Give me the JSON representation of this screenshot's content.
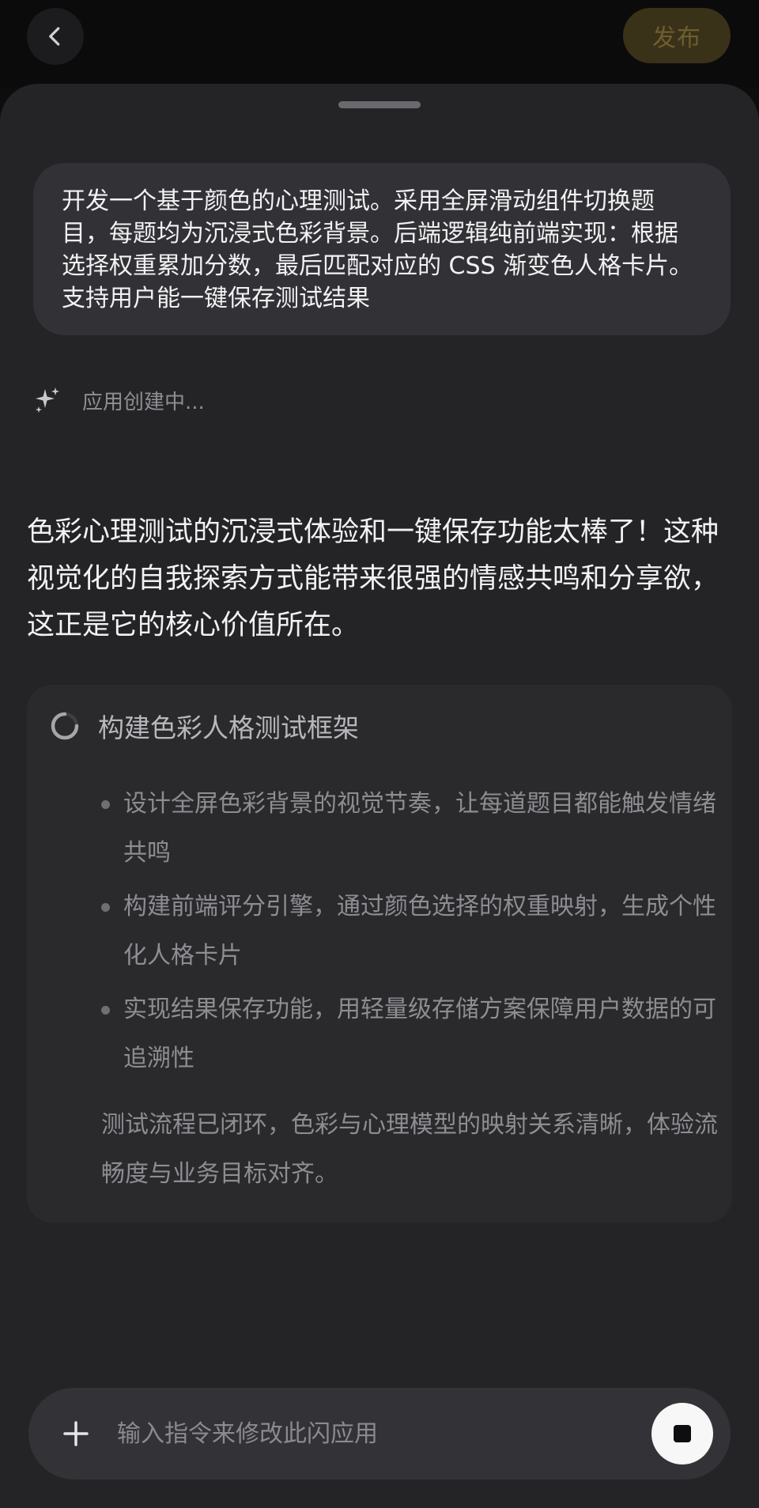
{
  "header": {
    "back_icon": "chevron-left-icon",
    "publish_label": "发布"
  },
  "prompt": {
    "text": "开发一个基于颜色的心理测试。采用全屏滑动组件切换题目，每题均为沉浸式色彩背景。后端逻辑纯前端实现：根据选择权重累加分数，最后匹配对应的 CSS 渐变色人格卡片。支持用户能一键保存测试结果"
  },
  "status": {
    "icon": "sparkle-icon",
    "text": "应用创建中..."
  },
  "reply": {
    "text": "色彩心理测试的沉浸式体验和一键保存功能太棒了！这种视觉化的自我探索方式能带来很强的情感共鸣和分享欲，这正是它的核心价值所在。"
  },
  "task": {
    "icon": "spinner-icon",
    "title": "构建色彩人格测试框架",
    "bullets": [
      "设计全屏色彩背景的视觉节奏，让每道题目都能触发情绪共鸣",
      "构建前端评分引擎，通过颜色选择的权重映射，生成个性化人格卡片",
      "实现结果保存功能，用轻量级存储方案保障用户数据的可追溯性"
    ],
    "summary": "测试流程已闭环，色彩与心理模型的映射关系清晰，体验流畅度与业务目标对齐。"
  },
  "composer": {
    "plus_icon": "plus-icon",
    "placeholder": "输入指令来修改此闪应用",
    "value": "",
    "stop_icon": "stop-icon"
  },
  "colors": {
    "background": "#0d0d0e",
    "sheet": "#242427",
    "bubble": "#323236",
    "card": "#2a2a2d",
    "publish_button": "#3a3119",
    "publish_text": "#6e5e30",
    "stop_button": "#f7f7f8"
  }
}
